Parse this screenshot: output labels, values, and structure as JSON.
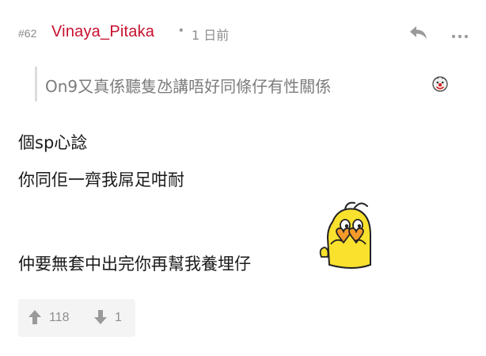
{
  "post": {
    "number": "#62",
    "username": "Vinaya_Pitaka",
    "separator": "•",
    "time_ago": "1 日前",
    "reply_icon": "reply-arrow-icon",
    "more_icon": "more-dots-icon"
  },
  "quote": {
    "text": "On9又真係聽隻氹講唔好同條仔有性關係",
    "emoji": "clown-face-emoji"
  },
  "content": {
    "line1": "個sp心諗",
    "line2": "你同佢一齊我屌足咁耐",
    "line3": "仲要無套中出完你再幫我養埋仔",
    "sticker": "yellow-banana-character-sticker"
  },
  "votes": {
    "up_count": "118",
    "down_count": "1",
    "up_icon": "thumb-arrow-up-icon",
    "down_icon": "thumb-arrow-down-icon"
  },
  "colors": {
    "username": "#c8102e",
    "meta_text": "#8e8e8e",
    "quote_text": "#7c7c7c",
    "body_text": "#1a1a1a",
    "vote_bg": "#f4f4f4"
  }
}
